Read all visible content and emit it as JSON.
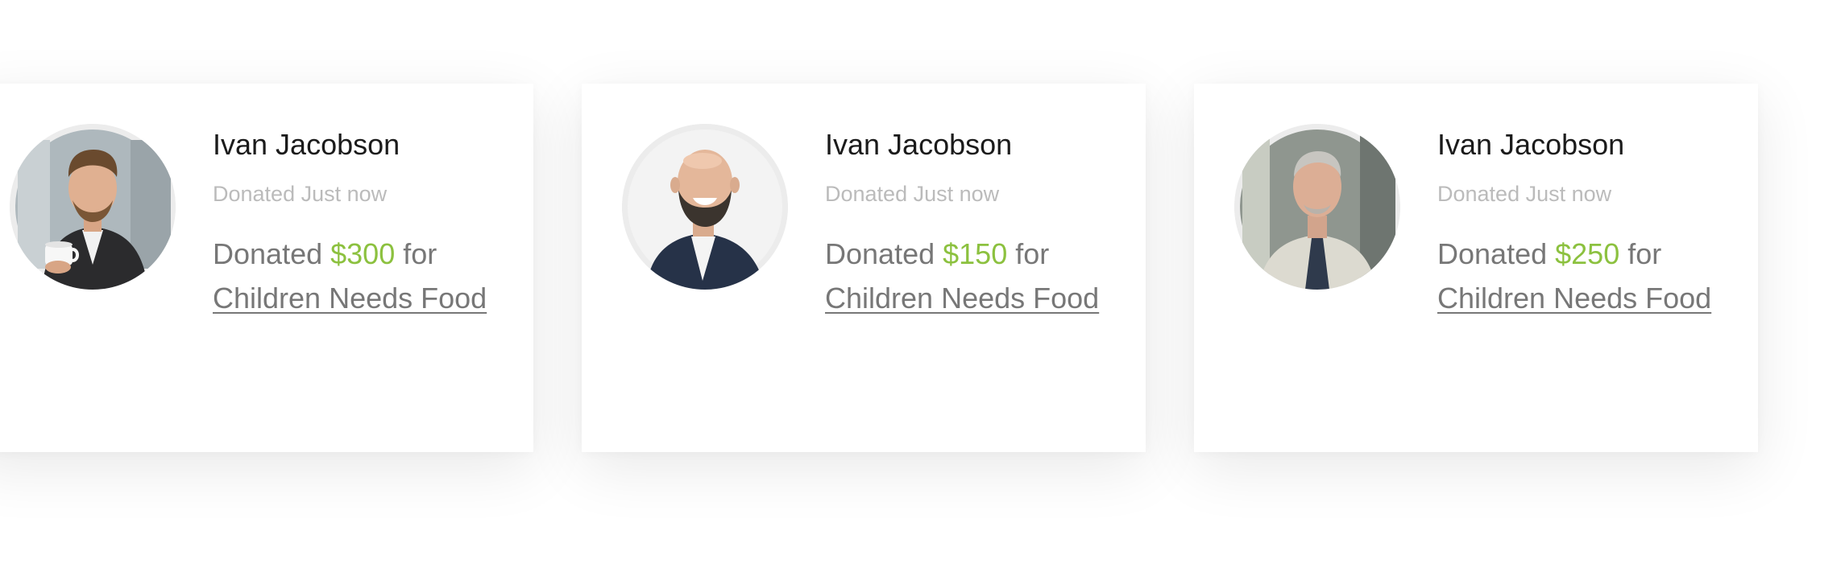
{
  "cards": [
    {
      "donor_name": "Ivan Jacobson",
      "time_label": "Donated Just now",
      "prefix": "Donated",
      "amount": "$300",
      "connector": "for",
      "cause": "Children Needs Food",
      "avatar_icon": "person-holding-cup-avatar"
    },
    {
      "donor_name": "Ivan Jacobson",
      "time_label": "Donated Just now",
      "prefix": "Donated",
      "amount": "$150",
      "connector": "for",
      "cause": "Children Needs Food",
      "avatar_icon": "laughing-bald-man-avatar"
    },
    {
      "donor_name": "Ivan Jacobson",
      "time_label": "Donated Just now",
      "prefix": "Donated",
      "amount": "$250",
      "connector": "for",
      "cause": "Children Needs Food",
      "avatar_icon": "older-man-avatar"
    }
  ],
  "colors": {
    "amount": "#8cc13f",
    "name": "#1b1b1b",
    "muted": "#bbbbbb",
    "body": "#777777"
  }
}
